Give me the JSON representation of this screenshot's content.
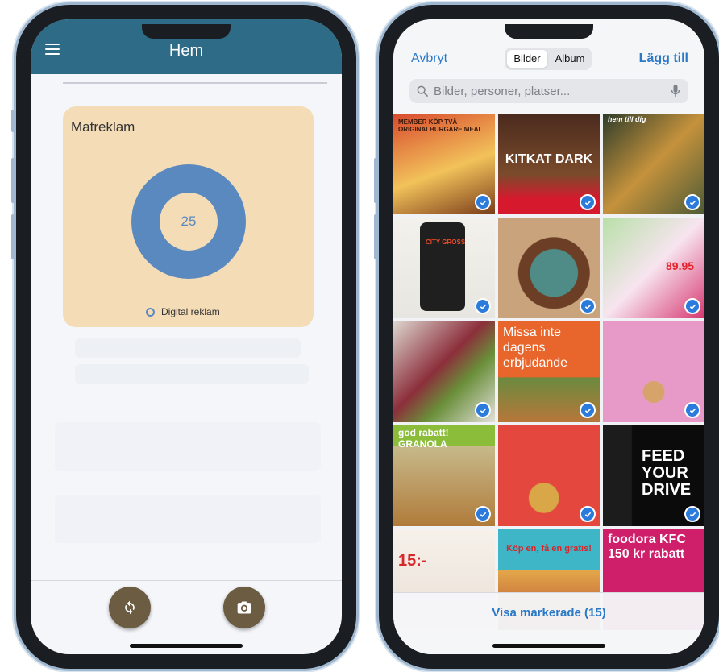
{
  "left_app": {
    "title": "Hem",
    "card_title": "Matreklam",
    "donut_value": "25",
    "legend_label": "Digital reklam",
    "colors": {
      "appbar": "#2d6b87",
      "card": "#f4dcb6",
      "donut": "#5a89c0",
      "fab": "#6b5c42"
    },
    "fab_icons": [
      "refresh-icon",
      "camera-icon"
    ]
  },
  "chart_data": {
    "type": "pie",
    "categories": [
      "Digital reklam"
    ],
    "values": [
      25
    ],
    "title": "Matreklam"
  },
  "picker": {
    "cancel_label": "Avbryt",
    "segments": [
      "Bilder",
      "Album"
    ],
    "selected_segment": "Bilder",
    "add_label": "Lägg till",
    "search_placeholder": "Bilder, personer, platser...",
    "show_selected_label": "Visa markerade (15)",
    "tiles": [
      {
        "caption": "MEMBER KÖP TVÅ ORIGINALBURGARE MEAL",
        "checked": true
      },
      {
        "caption": "KITKAT DARK",
        "checked": true
      },
      {
        "caption": "hem till dig",
        "checked": true
      },
      {
        "caption": "CITY GROSS",
        "checked": true
      },
      {
        "caption": "",
        "checked": true
      },
      {
        "caption": "89.95",
        "checked": true
      },
      {
        "caption": "",
        "checked": true
      },
      {
        "caption": "Missa inte dagens erbjudande",
        "checked": true
      },
      {
        "caption": "",
        "checked": true
      },
      {
        "caption": "god rabatt! GRANOLA",
        "checked": true
      },
      {
        "caption": "",
        "checked": true
      },
      {
        "caption": "FEED YOUR DRIVE",
        "checked": true
      },
      {
        "caption": "15:-",
        "checked": false
      },
      {
        "caption": "Köp en, få en gratis!",
        "checked": false
      },
      {
        "caption": "foodora KFC 150 kr rabatt",
        "checked": false
      }
    ]
  }
}
